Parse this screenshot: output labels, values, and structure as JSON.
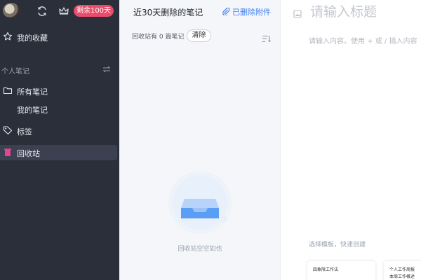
{
  "sidebar": {
    "remain_badge": "剩余100天",
    "favorites": "我的收藏",
    "section_title": "个人笔记",
    "all_notes": "所有笔记",
    "my_notes": "我的笔记",
    "tags": "标签",
    "recycle_bin": "回收站"
  },
  "middle": {
    "title": "近30天删除的笔记",
    "deleted_attachments": "已删除附件",
    "recycle_prefix": "回收站有",
    "recycle_count": "0",
    "recycle_suffix": "篇笔记",
    "clear_button": "清除",
    "empty_text": "回收站空空如也"
  },
  "editor": {
    "title_placeholder": "请输入标题",
    "content_placeholder": "请输入内容。使用 + 或 / 插入内容",
    "template_hint": "选择模板，快速创建",
    "templates": [
      {
        "line1": "四象限工作法",
        "line2": ""
      },
      {
        "line1": "个人工作周报",
        "line2": "本周工作概述"
      }
    ]
  },
  "colors": {
    "sidebar_bg": "#2b2f3a",
    "accent_blue": "#3c7cf0",
    "badge_pink": "#e84c6a",
    "recycle_icon": "#e84393"
  }
}
